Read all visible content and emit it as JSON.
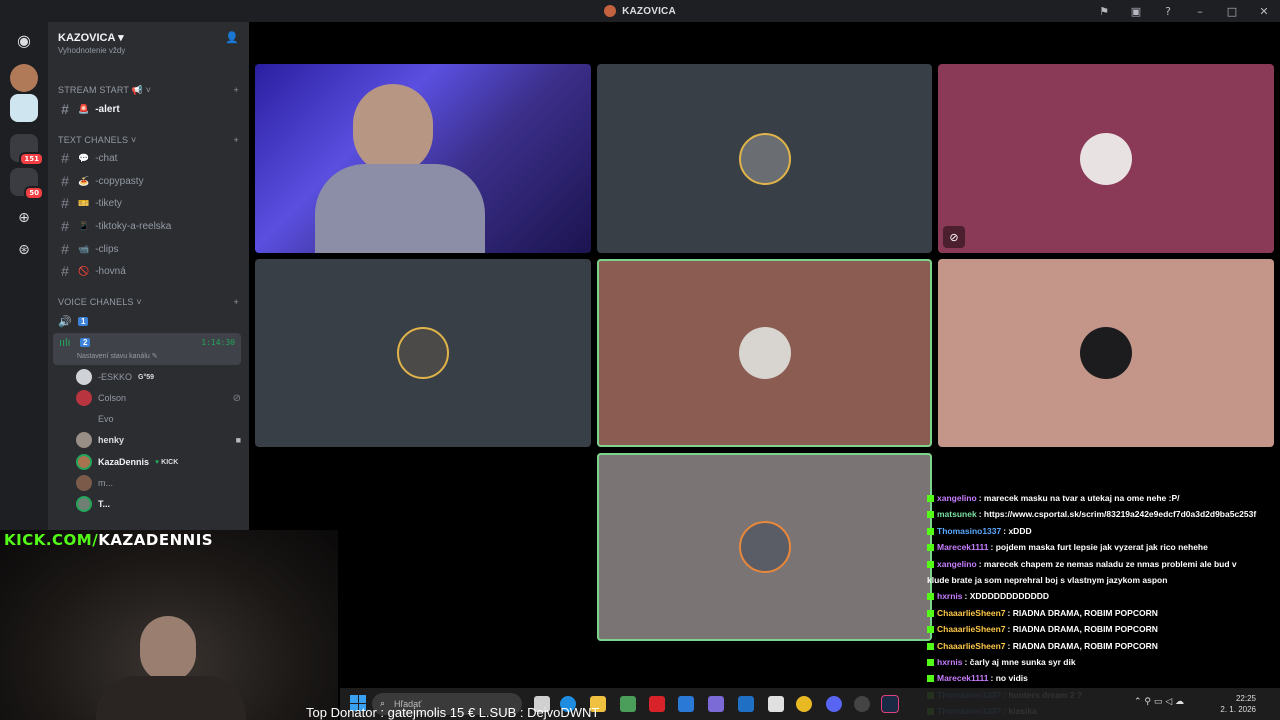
{
  "window": {
    "title": "KAZOVICA"
  },
  "server": {
    "name": "KAZOVICA",
    "cut_item": "Vyhodnotenie vždy"
  },
  "rail": {
    "badge_1": "151",
    "badge_2": "50"
  },
  "categories": {
    "stream_start": "STREAM START",
    "text": "TEXT CHANELS",
    "voice": "VOICE CHANELS"
  },
  "channels": {
    "alert": "-alert",
    "chat": "-chat",
    "copypasty": "-copypasty",
    "tikety": "-tikety",
    "tiktoky": "-tiktoky-a-reelska",
    "clips": "-clips",
    "hovna": "-hovná"
  },
  "voice": {
    "ch1": "1",
    "ch2": "2",
    "timer": "1:14:30",
    "status": "Nastavení stavu kanálu",
    "users": [
      {
        "name": "-ESKKO",
        "tag": "G°59"
      },
      {
        "name": "Colson",
        "tag": ""
      },
      {
        "name": "Evo",
        "tag": ""
      },
      {
        "name": "henky",
        "tag": ""
      },
      {
        "name": "KazaDennis",
        "tag": "KICK"
      },
      {
        "name": "m...",
        "tag": ""
      },
      {
        "name": "T...",
        "tag": ""
      }
    ]
  },
  "overlay": {
    "kick_prefix": "KICK.COM/",
    "kick_name": "KAZADENNIS",
    "donator": "Top Donator : gatejmolis 15 €  L.SUB : DejvoDWNT"
  },
  "chat": [
    {
      "user": "xangelino",
      "color": "#c77dff",
      "text": "marecek masku na tvar a utekaj na ome nehe :P/"
    },
    {
      "user": "matsunek",
      "color": "#7be0a2",
      "text": "https://www.csportal.sk/scrim/83219a242e9edcf7d0a3d2d9ba5c253f"
    },
    {
      "user": "Thomasino1337",
      "color": "#5aa9ff",
      "text": "xDDD"
    },
    {
      "user": "Marecek1111",
      "color": "#c77dff",
      "text": "pojdem maska furt lepsie jak vyzerat jak rico nehehe"
    },
    {
      "user": "xangelino",
      "color": "#c77dff",
      "text": "marecek chapem ze nemas naladu ze nmas problemi ale bud v"
    },
    {
      "user": "",
      "color": "#ffffff",
      "text": "klude brate ja som neprehral boj s vlastnym jazykom aspon"
    },
    {
      "user": "hxrnis",
      "color": "#c77dff",
      "text": "XDDDDDDDDDDDD"
    },
    {
      "user": "ChaaarlieSheen7",
      "color": "#ffc94a",
      "text": "RIADNA DRAMA, ROBIM POPCORN"
    },
    {
      "user": "ChaaarlieSheen7",
      "color": "#ffc94a",
      "text": "RIADNA DRAMA, ROBIM POPCORN"
    },
    {
      "user": "ChaaarlieSheen7",
      "color": "#ffc94a",
      "text": "RIADNA DRAMA, ROBIM POPCORN"
    },
    {
      "user": "hxrnis",
      "color": "#c77dff",
      "text": "čarly aj mne sunka syr dik"
    },
    {
      "user": "Marecek1111",
      "color": "#c77dff",
      "text": "no vidis"
    },
    {
      "user": "Thomasino1337",
      "color": "#5aa9ff",
      "text": "hunters dream 2 ?"
    },
    {
      "user": "Thomasino1337",
      "color": "#5aa9ff",
      "text": "klasika"
    }
  ],
  "taskbar": {
    "search_placeholder": "Hľadať",
    "time": "22:25",
    "date": "2. 1. 2026"
  },
  "colors": {
    "tile_dark": "#383f46",
    "tile_maroon": "#8a3a56",
    "tile_brown": "#8b5d52",
    "tile_peach": "#c4968a",
    "tile_grey": "#7a7574",
    "speaking": "#7bd48a",
    "kick_green": "#53fc18"
  }
}
